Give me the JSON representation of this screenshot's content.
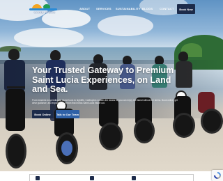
{
  "brand": {
    "name": "CARIB SPECS",
    "colors": {
      "navy": "#1c2b4a",
      "blue": "#2f61a7",
      "sun": "#f5a623",
      "palm": "#1f9a55"
    }
  },
  "nav": {
    "items": [
      {
        "label": "ABOUT"
      },
      {
        "label": "SERVICES"
      },
      {
        "label": "SUSTAINABILITY"
      },
      {
        "label": "BLOGS"
      },
      {
        "label": "CONTACT"
      }
    ],
    "cta": "Book Now"
  },
  "hero": {
    "headline": "Your Trusted Gateway to Premium Saint Lucia Experiences, on Land and Sea.",
    "subtext": "From beaches to speedboats, island tours to nightlife, Caribspecs curates the details so you can enjoy the island without the stress. Book online, get clear guidance, and explore with a team that knows Saint Lucia inside out.",
    "buttons": {
      "primary": "Book Online",
      "secondary": "Talk to Our Team"
    }
  },
  "widgets": {
    "captcha_icon": "recaptcha-icon"
  }
}
